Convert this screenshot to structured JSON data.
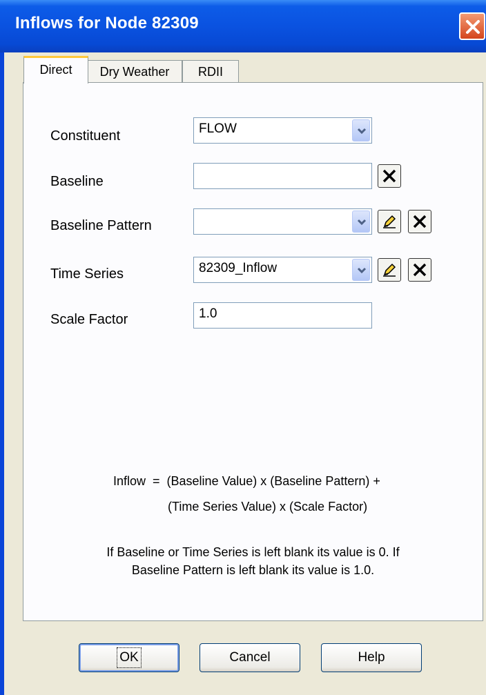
{
  "window": {
    "title": "Inflows for Node 82309"
  },
  "tabs": [
    {
      "label": "Direct",
      "active": true
    },
    {
      "label": "Dry Weather",
      "active": false
    },
    {
      "label": "RDII",
      "active": false
    }
  ],
  "form": {
    "constituent": {
      "label": "Constituent",
      "value": "FLOW"
    },
    "baseline": {
      "label": "Baseline",
      "value": ""
    },
    "baseline_pattern": {
      "label": "Baseline Pattern",
      "value": ""
    },
    "time_series": {
      "label": "Time Series",
      "value": "82309_Inflow"
    },
    "scale_factor": {
      "label": "Scale Factor",
      "value": "1.0"
    }
  },
  "formula": {
    "line1": "Inflow  =  (Baseline Value) x (Baseline Pattern) +",
    "line2": "(Time Series Value) x (Scale Factor)"
  },
  "note": {
    "line1": "If Baseline or Time Series is left blank its value is 0. If",
    "line2": "Baseline Pattern is left blank its value is 1.0."
  },
  "buttons": {
    "ok": "OK",
    "cancel": "Cancel",
    "help": "Help"
  },
  "colors": {
    "title_bar": "#0a52e0",
    "dialog_bg": "#ece9d8",
    "close_button": "#d4451c",
    "active_tab_accent": "#ffc83c"
  },
  "icons": {
    "close": "close-x-icon",
    "clear": "clear-x-icon",
    "edit": "edit-pencil-icon",
    "dropdown": "chevron-down-icon"
  }
}
